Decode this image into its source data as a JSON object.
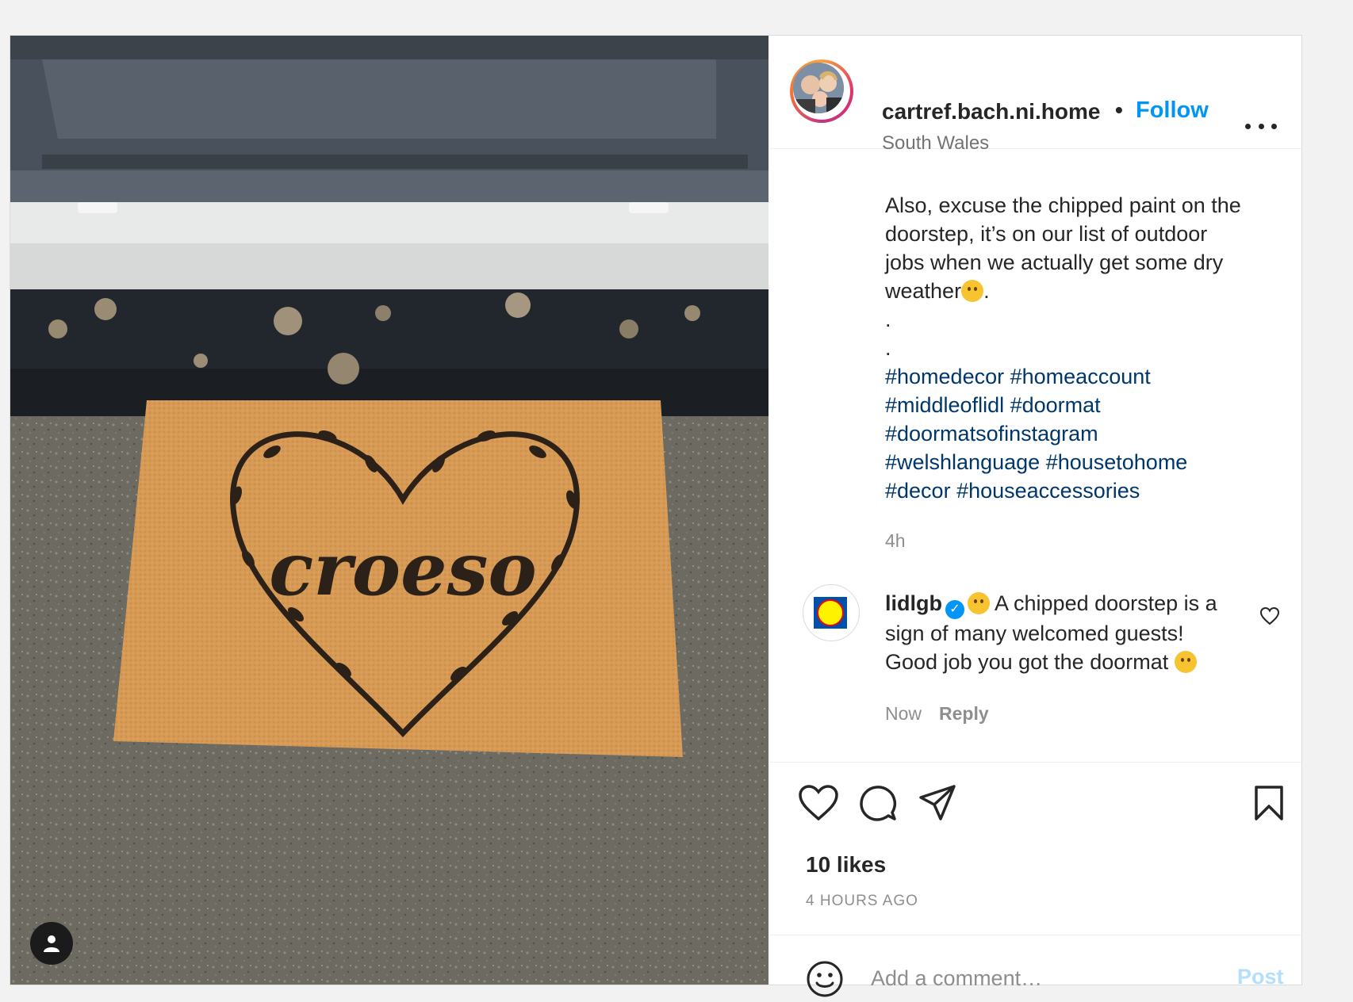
{
  "post": {
    "username": "cartref.bach.ni.home",
    "follow_label": "Follow",
    "separator": "•",
    "location": "South Wales",
    "caption_lines": [
      "Also, excuse the chipped paint on the",
      "doorstep, it’s on our list of outdoor",
      "jobs when we actually get some dry",
      "weather"
    ],
    "caption_end": ".",
    "caption_dots": [
      ".",
      "."
    ],
    "hashtags": [
      [
        "#homedecor",
        "#homeaccount"
      ],
      [
        "#middleoflidl",
        "#doormat"
      ],
      [
        "#doormatsofinstagram"
      ],
      [
        "#welshlanguage",
        "#housetohome"
      ],
      [
        "#decor",
        "#houseaccessories"
      ]
    ],
    "caption_time": "4h"
  },
  "comment": {
    "username": "lidlgb",
    "verified_mark": "✓",
    "text": " A chipped doorstep is a sign of many welcomed guests! Good job you got the doormat ",
    "time": "Now",
    "reply_label": "Reply",
    "avatar_label": "LIDL"
  },
  "photo": {
    "mat_text": "croeso"
  },
  "actions": {
    "likes": "10 likes",
    "time_ago": "4 HOURS AGO",
    "comment_placeholder": "Add a comment…",
    "post_label": "Post"
  },
  "colors": {
    "link_blue": "#0095f6",
    "hashtag": "#00376b",
    "mat": "#d79a55"
  },
  "icons": [
    "more-icon",
    "like-icon",
    "comment-icon",
    "share-icon",
    "save-icon",
    "emoji-icon",
    "user-icon",
    "verified-icon",
    "comment-like-icon"
  ]
}
